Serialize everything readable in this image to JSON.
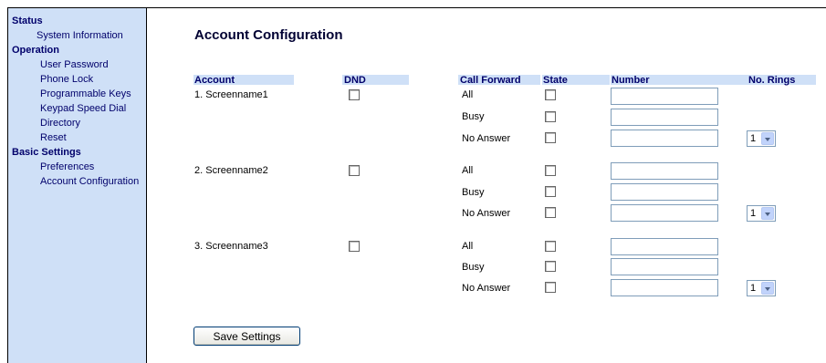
{
  "sidebar": {
    "status": {
      "heading": "Status",
      "items": [
        "System Information"
      ]
    },
    "operation": {
      "heading": "Operation",
      "items": [
        "User Password",
        "Phone Lock",
        "Programmable Keys",
        "Keypad Speed Dial",
        "Directory",
        "Reset"
      ]
    },
    "basic": {
      "heading": "Basic Settings",
      "items": [
        "Preferences",
        "Account Configuration"
      ]
    }
  },
  "page_title": "Account Configuration",
  "headers": {
    "account": "Account",
    "dnd": "DND",
    "call_forward": "Call Forward",
    "state": "State",
    "number": "Number",
    "no_rings": "No. Rings"
  },
  "forward_types": [
    "All",
    "Busy",
    "No Answer"
  ],
  "accounts": [
    {
      "name": "1. Screenname1",
      "rings": "1"
    },
    {
      "name": "2. Screenname2",
      "rings": "1"
    },
    {
      "name": "3. Screenname3",
      "rings": "1"
    }
  ],
  "save_label": "Save Settings",
  "colors": {
    "sidebar_bg": "#cfe0f7",
    "header_bg": "#cfe0f7",
    "nav_text": "#00006b"
  }
}
